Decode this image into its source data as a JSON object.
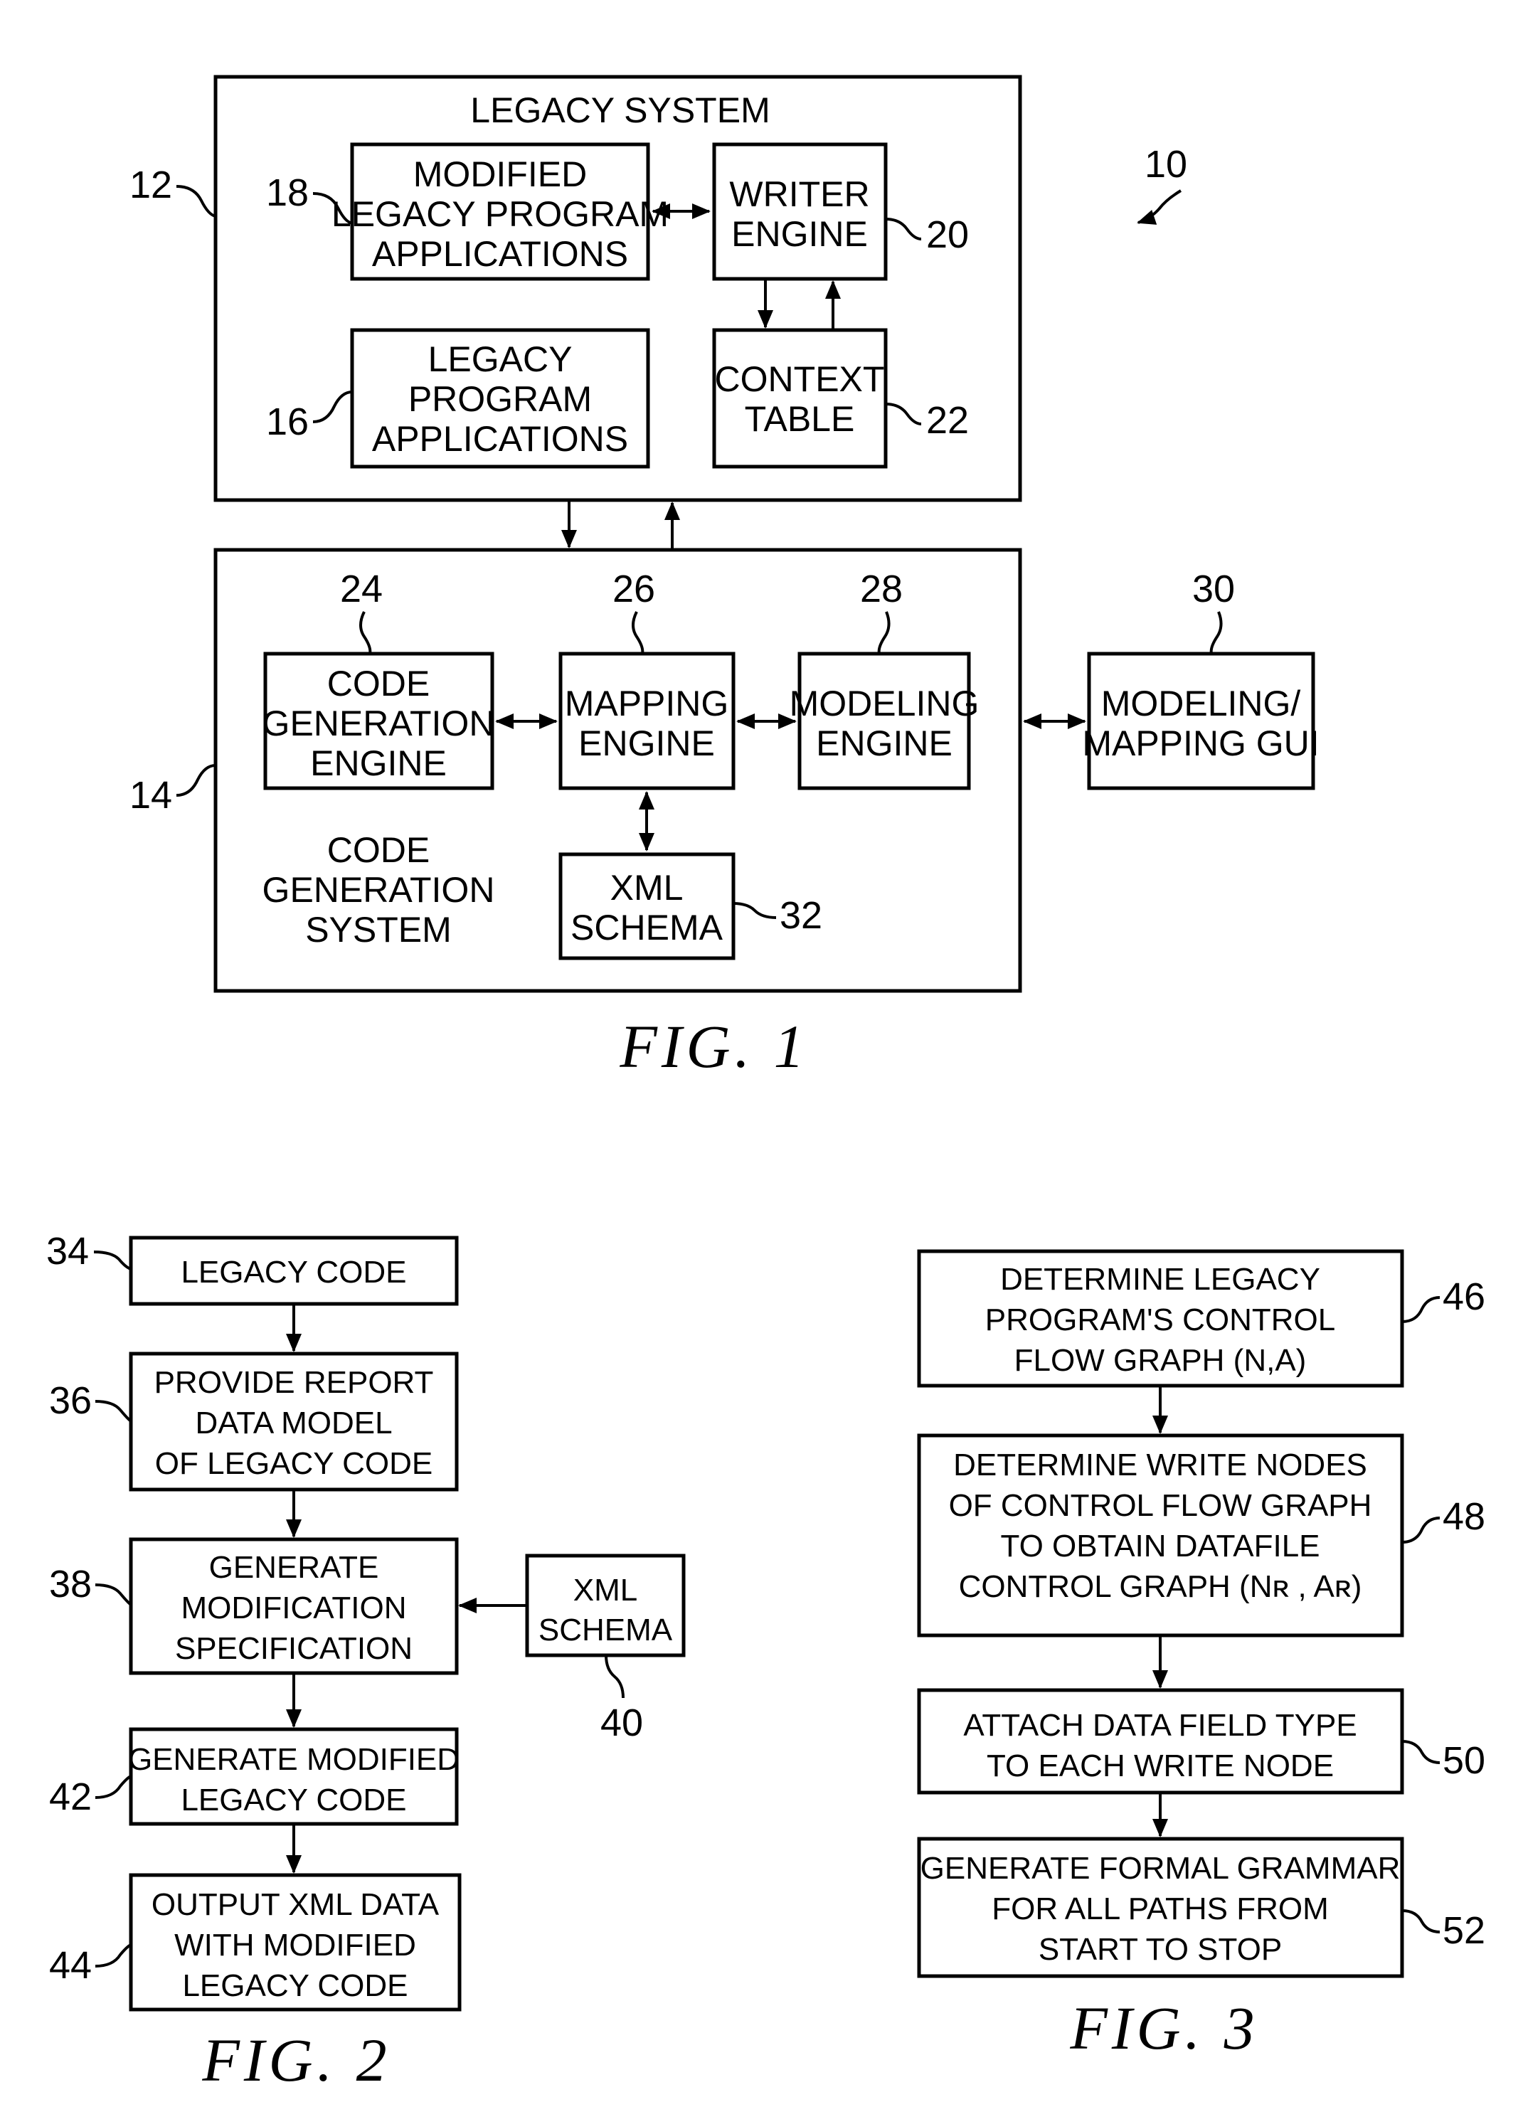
{
  "fig1": {
    "caption": "FIG.  1",
    "system_ref": "10",
    "legacy_system": {
      "title": "LEGACY SYSTEM",
      "ref": "12",
      "modified_apps": {
        "lines": [
          "MODIFIED",
          "LEGACY PROGRAM",
          "APPLICATIONS"
        ],
        "ref": "18"
      },
      "writer_engine": {
        "lines": [
          "WRITER",
          "ENGINE"
        ],
        "ref": "20"
      },
      "legacy_apps": {
        "lines": [
          "LEGACY",
          "PROGRAM",
          "APPLICATIONS"
        ],
        "ref": "16"
      },
      "context_table": {
        "lines": [
          "CONTEXT",
          "TABLE"
        ],
        "ref": "22"
      }
    },
    "code_gen_system": {
      "title_lines": [
        "CODE",
        "GENERATION",
        "SYSTEM"
      ],
      "ref": "14",
      "code_gen_engine": {
        "lines": [
          "CODE",
          "GENERATION",
          "ENGINE"
        ],
        "ref": "24"
      },
      "mapping_engine": {
        "lines": [
          "MAPPING",
          "ENGINE"
        ],
        "ref": "26"
      },
      "modeling_engine": {
        "lines": [
          "MODELING",
          "ENGINE"
        ],
        "ref": "28"
      },
      "xml_schema": {
        "lines": [
          "XML",
          "SCHEMA"
        ],
        "ref": "32"
      }
    },
    "gui": {
      "lines": [
        "MODELING/",
        "MAPPING GUI"
      ],
      "ref": "30"
    }
  },
  "fig2": {
    "caption": "FIG.  2",
    "steps": [
      {
        "lines": [
          "LEGACY CODE"
        ],
        "ref": "34"
      },
      {
        "lines": [
          "PROVIDE REPORT",
          "DATA MODEL",
          "OF LEGACY CODE"
        ],
        "ref": "36"
      },
      {
        "lines": [
          "GENERATE",
          "MODIFICATION",
          "SPECIFICATION"
        ],
        "ref": "38"
      },
      {
        "lines": [
          "GENERATE MODIFIED",
          "LEGACY CODE"
        ],
        "ref": "42"
      },
      {
        "lines": [
          "OUTPUT XML DATA",
          "WITH MODIFIED",
          "LEGACY CODE"
        ],
        "ref": "44"
      }
    ],
    "xml_schema": {
      "lines": [
        "XML",
        "SCHEMA"
      ],
      "ref": "40"
    }
  },
  "fig3": {
    "caption": "FIG.  3",
    "steps": [
      {
        "lines": [
          "DETERMINE LEGACY",
          "PROGRAM'S CONTROL",
          "FLOW GRAPH (N,A)"
        ],
        "ref": "46"
      },
      {
        "lines": [
          "DETERMINE WRITE NODES",
          "OF CONTROL FLOW GRAPH",
          "TO OBTAIN DATAFILE",
          "CONTROL GRAPH (Nʀ , Aʀ)"
        ],
        "ref": "48"
      },
      {
        "lines": [
          "ATTACH DATA FIELD TYPE",
          "TO EACH WRITE NODE"
        ],
        "ref": "50"
      },
      {
        "lines": [
          "GENERATE FORMAL GRAMMAR",
          "FOR ALL PATHS FROM",
          "START TO STOP"
        ],
        "ref": "52"
      }
    ]
  }
}
